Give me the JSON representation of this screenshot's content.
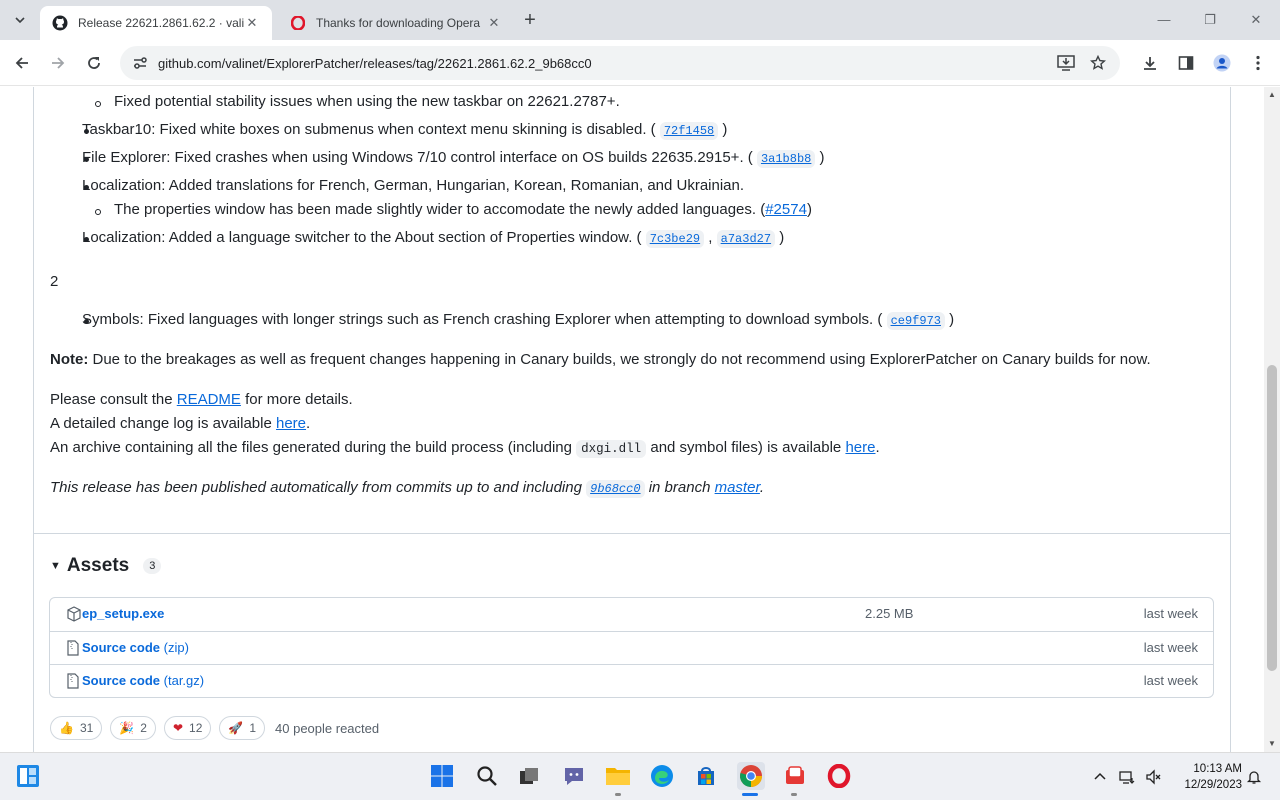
{
  "browser": {
    "tabs": [
      {
        "title": "Release 22621.2861.62.2 · valinet",
        "active": true
      },
      {
        "title": "Thanks for downloading Opera",
        "active": false
      }
    ],
    "url": "github.com/valinet/ExplorerPatcher/releases/tag/22621.2861.62.2_9b68cc0"
  },
  "release": {
    "items_top": [
      {
        "level": 2,
        "text": "Fixed potential stability issues when using the new taskbar on 22621.2787+."
      },
      {
        "level": 1,
        "text": "Taskbar10: Fixed white boxes on submenus when context menu skinning is disabled. (",
        "refs": [
          "72f1458"
        ],
        "end": ")"
      },
      {
        "level": 1,
        "text": "File Explorer: Fixed crashes when using Windows 7/10 control interface on OS builds 22635.2915+. (",
        "refs": [
          "3a1b8b8"
        ],
        "end": ")"
      },
      {
        "level": 1,
        "text": "Localization: Added translations for French, German, Hungarian, Korean, Romanian, and Ukrainian."
      },
      {
        "level": 2,
        "text": "The properties window has been made slightly wider to accomodate the newly added languages. (",
        "link": "#2574",
        "end": ")"
      },
      {
        "level": 1,
        "text": "Localization: Added a language switcher to the About section of Properties window. (",
        "refs": [
          "7c3be29",
          "a7a3d27"
        ],
        "end": ")"
      }
    ],
    "section_num": "2",
    "items_bottom": [
      {
        "text": "Symbols: Fixed languages with longer strings such as French crashing Explorer when attempting to download symbols. (",
        "refs": [
          "ce9f973"
        ],
        "end": ")"
      }
    ],
    "note_label": "Note:",
    "note_text": " Due to the breakages as well as frequent changes happening in Canary builds, we strongly do not recommend using ExplorerPatcher on Canary builds for now.",
    "consult_pre": "Please consult the ",
    "consult_link": "README",
    "consult_post": " for more details.",
    "changelog_pre": "A detailed change log is available ",
    "changelog_link": "here",
    "changelog_post": ".",
    "archive_pre": "An archive containing all the files generated during the build process (including ",
    "archive_code": "dxgi.dll",
    "archive_mid": " and symbol files) is available ",
    "archive_link": "here",
    "archive_post": ".",
    "auto_pre": "This release has been published automatically from commits up to and including ",
    "auto_sha": "9b68cc0",
    "auto_mid": " in branch ",
    "auto_branch": "master",
    "auto_post": "."
  },
  "assets": {
    "title": "Assets",
    "count": "3",
    "rows": [
      {
        "name": "ep_setup.exe",
        "ext": "",
        "size": "2.25 MB",
        "date": "last week",
        "icon": "package-icon"
      },
      {
        "name": "Source code",
        "ext": " (zip)",
        "size": "",
        "date": "last week",
        "icon": "file-zip-icon"
      },
      {
        "name": "Source code",
        "ext": " (tar.gz)",
        "size": "",
        "date": "last week",
        "icon": "file-zip-icon"
      }
    ]
  },
  "reactions": {
    "items": [
      {
        "emoji": "👍",
        "count": "31",
        "name": "thumbs-up"
      },
      {
        "emoji": "🎉",
        "count": "2",
        "name": "hooray"
      },
      {
        "emoji": "❤",
        "count": "12",
        "name": "heart"
      },
      {
        "emoji": "🚀",
        "count": "1",
        "name": "rocket"
      }
    ],
    "summary": "40 people reacted"
  },
  "taskbar": {
    "time": "10:13 AM",
    "date": "12/29/2023"
  },
  "colors": {
    "link": "#0969da",
    "border": "#d0d7de",
    "tabstrip": "#dee1e6"
  }
}
